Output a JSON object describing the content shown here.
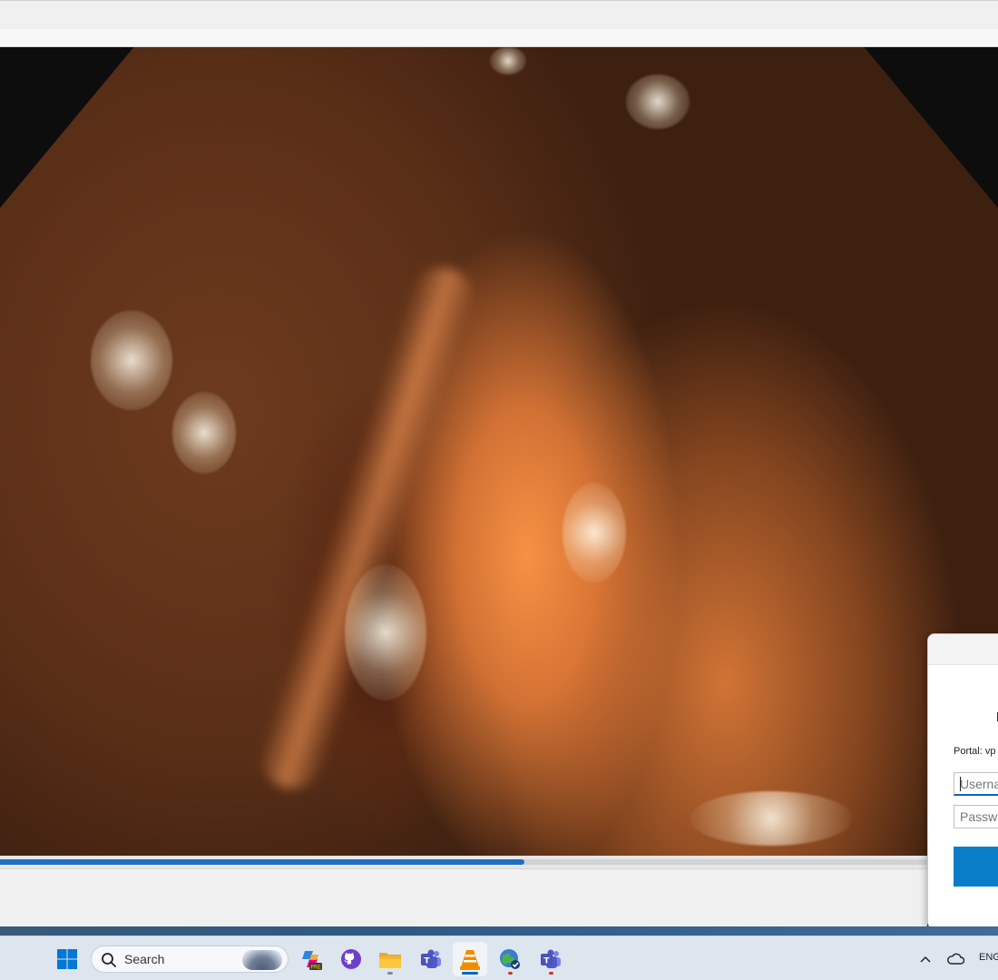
{
  "video": {
    "progress_fraction": 0.566
  },
  "vpn_dialog": {
    "portal_label": "Portal: vp",
    "username_placeholder": "Userna",
    "password_placeholder": "Passwo"
  },
  "taskbar": {
    "search_placeholder": "Search",
    "tray_language": "ENG",
    "apps": [
      {
        "icon": "windows-start-icon"
      },
      {
        "icon": "search-icon"
      },
      {
        "icon": "copilot-pre-icon"
      },
      {
        "icon": "github-icon"
      },
      {
        "icon": "file-explorer-icon"
      },
      {
        "icon": "teams-icon"
      },
      {
        "icon": "vlc-icon"
      },
      {
        "icon": "vpn-globe-icon"
      },
      {
        "icon": "teams-icon"
      },
      {
        "icon": "chevron-up-icon"
      },
      {
        "icon": "onedrive-cloud-icon"
      }
    ]
  },
  "colors": {
    "accent": "#0067c0",
    "seek_fill": "#1f6fc0",
    "connect_button": "#0a7dc9"
  }
}
